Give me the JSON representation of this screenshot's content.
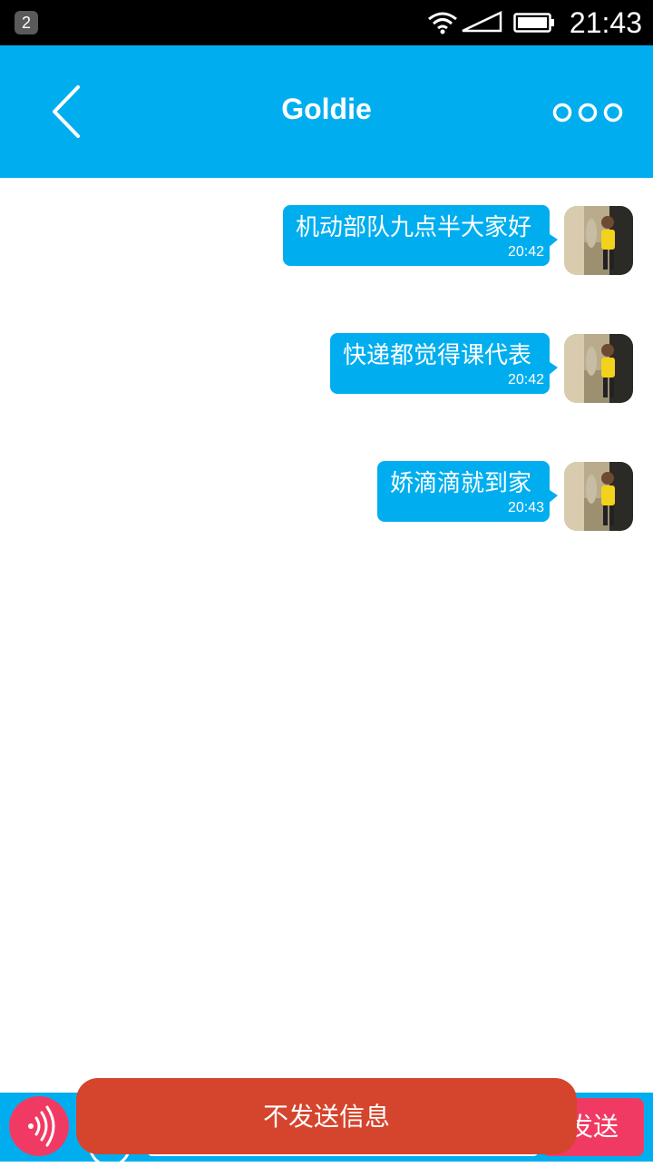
{
  "status_bar": {
    "notification_count": "2",
    "time": "21:43",
    "icons": [
      "wifi-icon",
      "signal-icon",
      "battery-icon"
    ]
  },
  "header": {
    "title": "Goldie",
    "back_icon": "chevron-left-icon",
    "more_icon": "more-dots-icon"
  },
  "messages": [
    {
      "text": "机动部队九点半大家好",
      "time": "20:42"
    },
    {
      "text": "快递都觉得课代表",
      "time": "20:42"
    },
    {
      "text": "娇滴滴就到家",
      "time": "20:43"
    }
  ],
  "input_bar": {
    "voice_icon": "voice-wave-icon",
    "emoji_icon": "emoji-icon",
    "input_value": "",
    "send_label": "发送"
  },
  "recording_toast": {
    "label": "不发送信息"
  },
  "colors": {
    "primary": "#00aeef",
    "accent": "#f13a63",
    "toast": "#d5442d"
  }
}
